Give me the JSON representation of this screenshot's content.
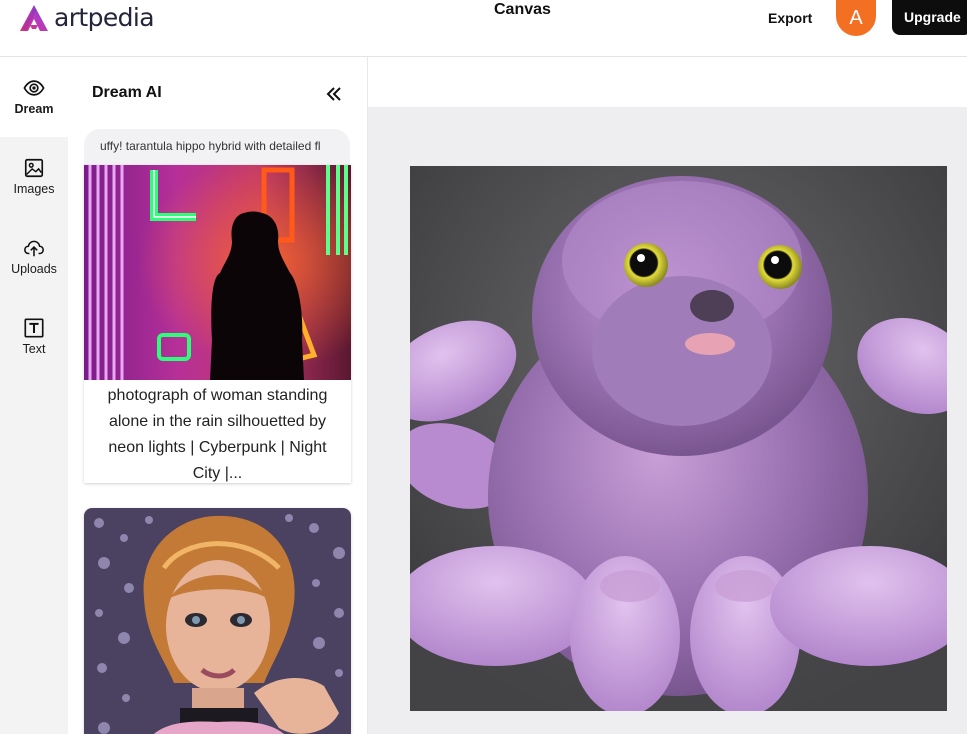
{
  "brand": {
    "name": "artpedia"
  },
  "header": {
    "title": "Canvas",
    "export_label": "Export",
    "avatar_initial": "A",
    "upgrade_label": "Upgrade"
  },
  "rail": {
    "items": [
      {
        "label": "Dream",
        "icon": "eye-icon"
      },
      {
        "label": "Images",
        "icon": "image-icon"
      },
      {
        "label": "Uploads",
        "icon": "cloud-upload-icon"
      },
      {
        "label": "Text",
        "icon": "text-icon"
      }
    ]
  },
  "panel": {
    "title": "Dream AI",
    "prompt_text": "uffy! tarantula hippo hybrid with detailed fl",
    "cards": [
      {
        "caption": "photograph of woman standing alone in the rain silhouetted by neon lights | Cyberpunk | Night City |..."
      }
    ]
  },
  "colors": {
    "accent_orange": "#f36f21",
    "upgrade_bg": "#0d0d0d",
    "canvas_bg": "#eeeef1",
    "rail_bg": "#f3f3f4"
  }
}
